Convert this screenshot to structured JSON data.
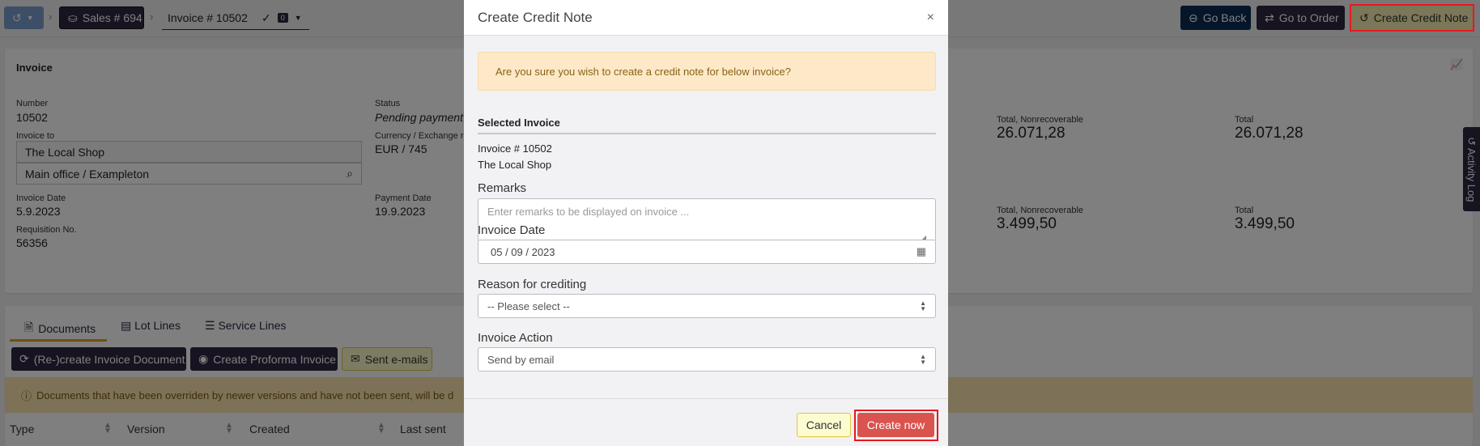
{
  "topbar": {
    "sales": "Sales # 694",
    "invoice_tab": "Invoice # 10502",
    "check_count": "0",
    "go_back": "Go Back",
    "go_to_order": "Go to Order",
    "create_credit_note": "Create Credit Note"
  },
  "invoice": {
    "title": "Invoice",
    "number_label": "Number",
    "number": "10502",
    "status_label": "Status",
    "status": "Pending payment",
    "invoice_to_label": "Invoice to",
    "customer": "The Local Shop",
    "address": "Main office / Exampleton",
    "currency_label": "Currency / Exchange rate",
    "currency": "EUR / 745",
    "invoice_date_label": "Invoice Date",
    "invoice_date": "5.9.2023",
    "payment_date_label": "Payment Date",
    "payment_date": "19.9.2023",
    "requisition_label": "Requisition No.",
    "requisition": "56356",
    "totals": [
      {
        "nr_label": "Total, Nonrecoverable",
        "nr": "26.071,28",
        "total_label": "Total",
        "total": "26.071,28"
      },
      {
        "nr_label": "Total, Nonrecoverable",
        "nr": "3.499,50",
        "total_label": "Total",
        "total": "3.499,50"
      }
    ]
  },
  "activity_log": "Activity Log",
  "tabs": [
    "Documents",
    "Lot Lines",
    "Service Lines"
  ],
  "doc_buttons": {
    "recreate": "(Re-)create Invoice Document",
    "proforma": "Create Proforma Invoice",
    "sent": "Sent e-mails"
  },
  "doc_warning": "Documents that have been overriden by newer versions and have not been sent, will be d",
  "table_headers": [
    "Type",
    "Version",
    "Created",
    "Last sent"
  ],
  "modal": {
    "title": "Create Credit Note",
    "close": "×",
    "alert": "Are you sure you wish to create a credit note for below invoice?",
    "selected_heading": "Selected Invoice",
    "selected_invoice": "Invoice # 10502",
    "selected_customer": "The Local Shop",
    "remarks_label": "Remarks",
    "remarks_placeholder": "Enter remarks to be displayed on invoice ...",
    "date_label": "Invoice Date",
    "date_value": "05 / 09 / 2023",
    "reason_label": "Reason for crediting",
    "reason_value": "-- Please select --",
    "action_label": "Invoice Action",
    "action_value": "Send by email",
    "cancel": "Cancel",
    "create": "Create now"
  },
  "colors": {
    "highlight": "#e8171f",
    "create_now": "#d9534f",
    "navy": "#0b2a55",
    "purple": "#2f2640"
  }
}
